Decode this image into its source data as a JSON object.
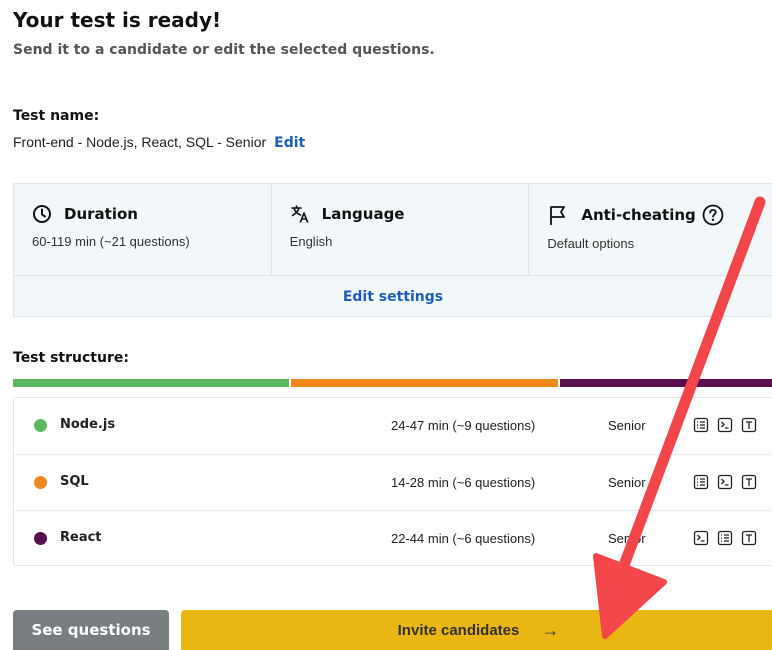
{
  "header": {
    "title": "Your test is ready!",
    "subtitle": "Send it to a candidate or edit the selected questions."
  },
  "test_name": {
    "label": "Test name:",
    "value": "Front-end - Node.js, React, SQL - Senior",
    "edit_label": "Edit"
  },
  "settings": {
    "duration": {
      "title": "Duration",
      "value": "60-119 min (~21 questions)",
      "icon": "clock-icon"
    },
    "language": {
      "title": "Language",
      "value": "English",
      "icon": "translate-icon"
    },
    "anti_cheating": {
      "title": "Anti-cheating",
      "value": "Default options",
      "icon": "flag-icon",
      "help_icon": "help-circle-icon"
    },
    "edit_label": "Edit settings"
  },
  "structure": {
    "label": "Test structure:",
    "skills": [
      {
        "name": "Node.js",
        "duration": "24-47 min (~9 questions)",
        "level": "Senior",
        "color": "#5cb85c",
        "icons": [
          "list-icon",
          "terminal-icon",
          "text-icon"
        ]
      },
      {
        "name": "SQL",
        "duration": "14-28 min (~6 questions)",
        "level": "Senior",
        "color": "#f0891d",
        "icons": [
          "list-icon",
          "terminal-icon",
          "text-icon"
        ]
      },
      {
        "name": "React",
        "duration": "22-44 min (~6 questions)",
        "level": "Senior",
        "color": "#5a0f4e",
        "icons": [
          "terminal-icon",
          "list-icon",
          "text-icon"
        ]
      }
    ]
  },
  "actions": {
    "see_questions": "See questions",
    "invite_candidates": "Invite candidates",
    "invite_arrow": "→"
  },
  "colors": {
    "link": "#1d5fb8",
    "invite_button": "#eab614",
    "see_button": "#787d80",
    "annotation_arrow": "#f2464b"
  }
}
